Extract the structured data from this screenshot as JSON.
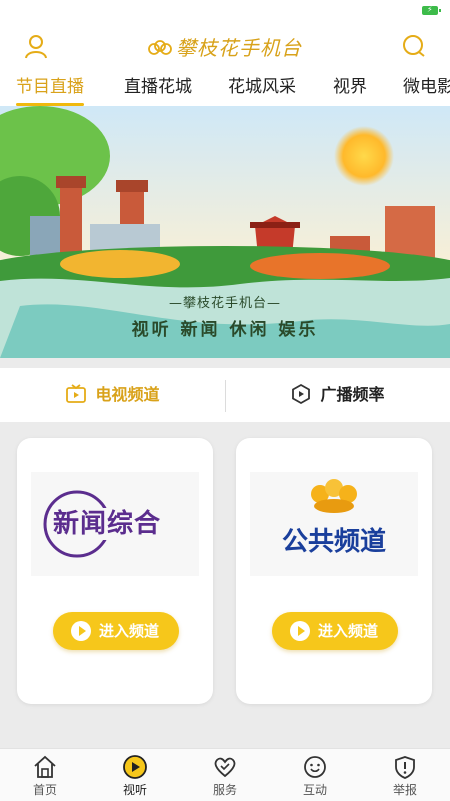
{
  "status": {
    "battery_glyph": "⚡"
  },
  "header": {
    "title": "攀枝花手机台",
    "user_icon": "user-icon",
    "search_icon": "search-icon",
    "accent": "#d9a21a"
  },
  "tabs": [
    {
      "label": "节目直播",
      "active": true
    },
    {
      "label": "直播花城",
      "active": false
    },
    {
      "label": "花城风采",
      "active": false
    },
    {
      "label": "视界",
      "active": false
    },
    {
      "label": "微电影",
      "active": false
    }
  ],
  "banner": {
    "caption": "—攀枝花手机台—",
    "subtitle": "视听 新闻 休闲 娱乐"
  },
  "switcher": {
    "tv_label": "电视频道",
    "radio_label": "广播频率"
  },
  "channels": [
    {
      "logo_text": "新闻综合",
      "button_label": "进入频道",
      "logo_color": "#5b2d8e"
    },
    {
      "logo_text": "公共频道",
      "button_label": "进入频道",
      "logo_color": "#1a3f9c"
    }
  ],
  "bottom_nav": [
    {
      "label": "首页",
      "icon": "home-icon"
    },
    {
      "label": "视听",
      "icon": "play-icon",
      "active": true
    },
    {
      "label": "服务",
      "icon": "heart-icon"
    },
    {
      "label": "互动",
      "icon": "chat-face-icon"
    },
    {
      "label": "举报",
      "icon": "shield-icon"
    }
  ]
}
